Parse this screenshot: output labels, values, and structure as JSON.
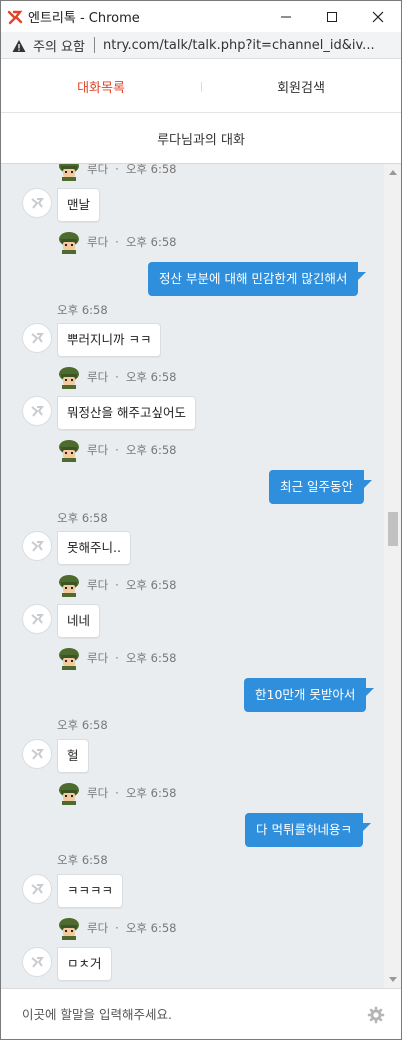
{
  "window": {
    "title": "엔트리톡 - Chrome",
    "min_glyph": "─",
    "max_glyph": "☐",
    "close_glyph": "✕"
  },
  "address": {
    "warning": "주의 요함",
    "url": "ntry.com/talk/talk.php?it=channel_id&iv..."
  },
  "tabs": [
    {
      "label": "대화목록",
      "active": true
    },
    {
      "label": "회원검색",
      "active": false
    }
  ],
  "conversation_title": "루다님과의 대화",
  "colors": {
    "accent": "#e0452b",
    "outgoing_bubble": "#2f8fdc",
    "chat_bg": "#eaedf0"
  },
  "messages": {
    "m0_meta": {
      "name": "루다",
      "time": "오후 6:58"
    },
    "m1": {
      "text": "맨날"
    },
    "m1_meta": {
      "name": "루다",
      "time": "오후 6:58"
    },
    "m2": {
      "text": "정산 부분에 대해 민감한게 많긴해서"
    },
    "m2_time": "오후 6:58",
    "m3": {
      "text": "뿌러지니까 ㅋㅋ"
    },
    "m3_meta": {
      "name": "루다",
      "time": "오후 6:58"
    },
    "m4": {
      "text": "뭐정산을 해주고싶어도"
    },
    "m4_meta": {
      "name": "루다",
      "time": "오후 6:58"
    },
    "m5": {
      "text": "최근 일주동안"
    },
    "m5_time": "오후 6:58",
    "m6": {
      "text": "못해주니.."
    },
    "m6_meta": {
      "name": "루다",
      "time": "오후 6:58"
    },
    "m7": {
      "text": "네네"
    },
    "m7_meta": {
      "name": "루다",
      "time": "오후 6:58"
    },
    "m8": {
      "text": "한10만개 못받아서"
    },
    "m8_time": "오후 6:58",
    "m9": {
      "text": "헐"
    },
    "m9_meta": {
      "name": "루다",
      "time": "오후 6:58"
    },
    "m10": {
      "text": "다 먹튀를하네용ㅋ"
    },
    "m10_time": "오후 6:58",
    "m11": {
      "text": "ㅋㅋㅋㅋ"
    },
    "m11_meta": {
      "name": "루다",
      "time": "오후 6:58"
    },
    "m12": {
      "text": "ㅁㅊ거"
    }
  },
  "input": {
    "placeholder": "이곳에 할말을 입력해주세요."
  },
  "icons": {
    "app": "entry-logo-icon",
    "warning": "warning-triangle-icon",
    "avatar": "soldier-avatar-icon",
    "default_avatar": "entry-default-avatar-icon",
    "settings": "gear-icon"
  }
}
